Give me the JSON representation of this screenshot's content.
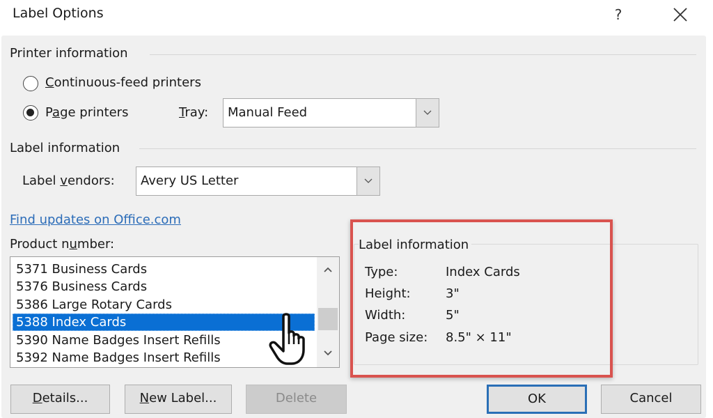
{
  "dialog": {
    "title": "Label Options",
    "help_label": "?",
    "close_icon": "close-x-icon"
  },
  "printer_information": {
    "heading": "Printer information",
    "options": [
      {
        "label": "Continuous-feed printers",
        "accel": "C",
        "rest": "ontinuous-feed printers",
        "checked": false
      },
      {
        "label": "Page printers",
        "pre": "P",
        "accel": "a",
        "rest": "ge printers",
        "checked": true
      }
    ],
    "tray": {
      "label": "Tray:",
      "accel": "T",
      "rest": "ray:",
      "value": "Manual Feed"
    }
  },
  "label_information": {
    "heading": "Label information",
    "vendors": {
      "label": "Label vendors:",
      "pre": "Label ",
      "accel": "v",
      "rest": "endors:",
      "value": "Avery US Letter"
    },
    "updates_link": "Find updates on Office.com",
    "product_number": {
      "label": "Product number:",
      "pre": "Product n",
      "accel": "u",
      "rest": "mber:",
      "items": [
        "5371 Business Cards",
        "5376 Business Cards",
        "5386 Large Rotary Cards",
        "5388 Index Cards",
        "5390 Name Badges Insert Refills",
        "5392 Name Badges Insert Refills"
      ],
      "selected_index": 3
    }
  },
  "label_details": {
    "heading": "Label information",
    "rows": [
      {
        "key": "Type:",
        "value": "Index Cards"
      },
      {
        "key": "Height:",
        "value": "3\""
      },
      {
        "key": "Width:",
        "value": "5\""
      },
      {
        "key": "Page size:",
        "value": "8.5\" × 11\""
      }
    ],
    "highlight_color": "#d9534f"
  },
  "buttons": {
    "details": {
      "label": "Details...",
      "accel": "D",
      "rest": "etails..."
    },
    "new_label": {
      "label": "New Label...",
      "accel": "N",
      "rest": "ew Label..."
    },
    "delete": {
      "label": "Delete",
      "enabled": false
    },
    "ok": {
      "label": "OK"
    },
    "cancel": {
      "label": "Cancel"
    }
  },
  "colors": {
    "selection": "#0a6fd4",
    "link": "#2b6cb8",
    "default_button_border": "#2a6fb6"
  }
}
